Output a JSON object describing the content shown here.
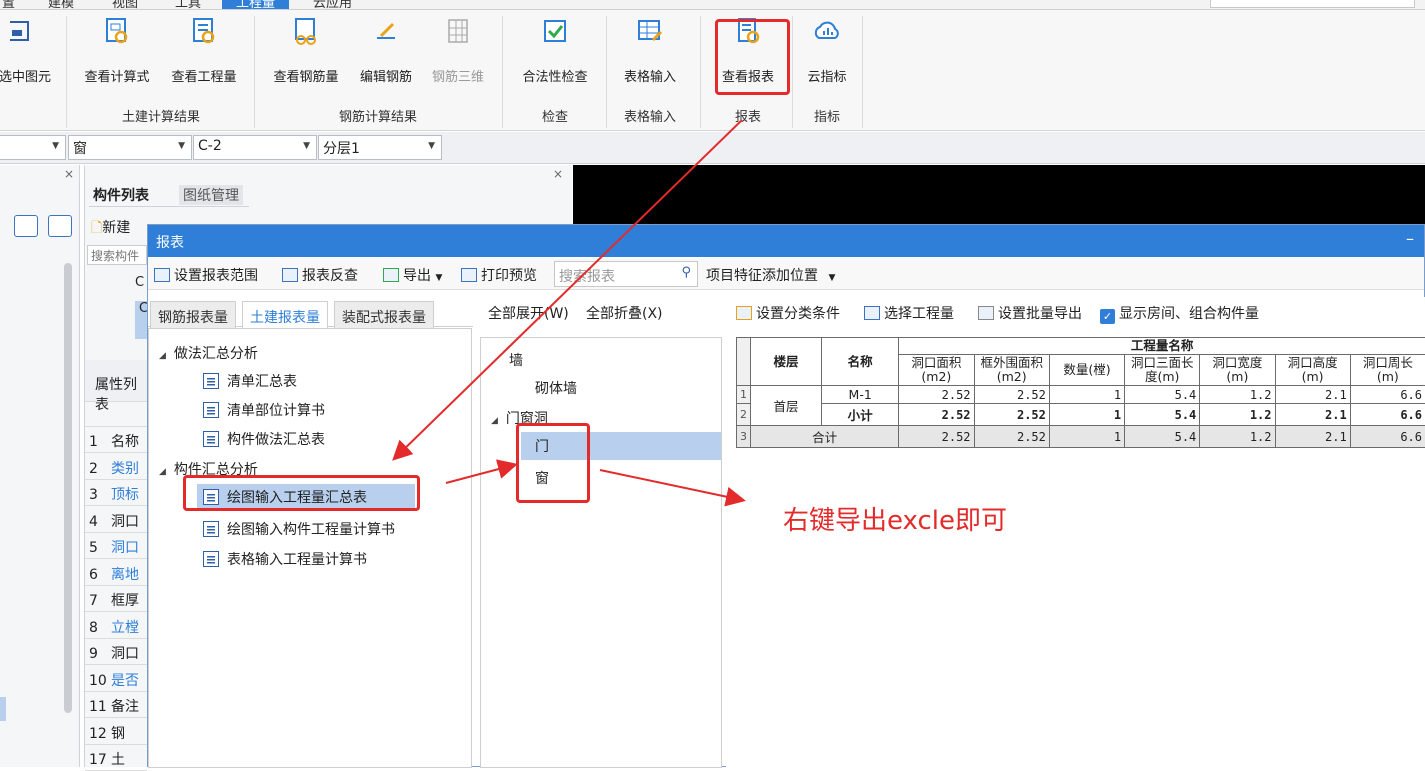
{
  "menubar": {
    "items": [
      "置",
      "建模",
      "视图",
      "工具",
      "工程量",
      "云应用"
    ],
    "active_index": 4
  },
  "ribbon": {
    "buttons": [
      {
        "label": "选中图元",
        "icon": "select-element-icon"
      },
      {
        "label": "查看计算式",
        "icon": "view-formula-icon"
      },
      {
        "label": "查看工程量",
        "icon": "view-quantity-icon"
      },
      {
        "label": "查看钢筋量",
        "icon": "view-rebar-icon"
      },
      {
        "label": "编辑钢筋",
        "icon": "edit-rebar-icon"
      },
      {
        "label": "钢筋三维",
        "icon": "rebar-3d-icon",
        "disabled": true
      },
      {
        "label": "合法性检查",
        "icon": "validity-check-icon"
      },
      {
        "label": "表格输入",
        "icon": "table-input-icon"
      },
      {
        "label": "查看报表",
        "icon": "view-report-icon"
      },
      {
        "label": "云指标",
        "icon": "cloud-index-icon"
      }
    ],
    "groups": [
      "土建计算结果",
      "钢筋计算结果",
      "检查",
      "表格输入",
      "报表",
      "指标"
    ]
  },
  "combobar": {
    "combo1": "",
    "combo2": "窗",
    "combo3": "C-2",
    "combo4": "分层1"
  },
  "mid_panel": {
    "tabs": [
      "构件列表",
      "图纸管理"
    ],
    "new_label": "新建",
    "search_placeholder": "搜索构件",
    "props_title": "属性列表",
    "rows": [
      {
        "n": "1",
        "t": "名称"
      },
      {
        "n": "2",
        "t": "类别"
      },
      {
        "n": "3",
        "t": "顶标"
      },
      {
        "n": "4",
        "t": "洞口"
      },
      {
        "n": "5",
        "t": "洞口"
      },
      {
        "n": "6",
        "t": "离地"
      },
      {
        "n": "7",
        "t": "框厚"
      },
      {
        "n": "8",
        "t": "立樘"
      },
      {
        "n": "9",
        "t": "洞口"
      },
      {
        "n": "10",
        "t": "是否"
      },
      {
        "n": "11",
        "t": "备注"
      },
      {
        "n": "12",
        "t": "钢"
      },
      {
        "n": "17",
        "t": "土"
      }
    ]
  },
  "dialog": {
    "title": "报表",
    "toolbar": {
      "set_range": "设置报表范围",
      "reverse": "报表反查",
      "export": "导出",
      "print_preview": "打印预览",
      "search_placeholder": "搜索报表",
      "add_position": "项目特征添加位置"
    },
    "tabs": [
      "钢筋报表量",
      "土建报表量",
      "装配式报表量"
    ],
    "active_tab": 1,
    "tree": {
      "group1": "做法汇总分析",
      "group1_items": [
        "清单汇总表",
        "清单部位计算书",
        "构件做法汇总表"
      ],
      "group2": "构件汇总分析",
      "group2_items": [
        "绘图输入工程量汇总表",
        "绘图输入构件工程量计算书",
        "表格输入工程量计算书"
      ]
    },
    "cat": {
      "expand_all": "全部展开(W)",
      "collapse_all": "全部折叠(X)",
      "items": [
        "墙",
        "砌体墙",
        "门窗洞",
        "门",
        "窗"
      ]
    },
    "grid_toolbar": {
      "set_category": "设置分类条件",
      "select_qty": "选择工程量",
      "batch_export": "设置批量导出",
      "show_room": "显示房间、组合构件量"
    },
    "grid": {
      "header_floor": "楼层",
      "header_name": "名称",
      "header_group": "工程量名称",
      "columns": [
        "洞口面积(m2)",
        "框外围面积(m2)",
        "数量(樘)",
        "洞口三面长度(m)",
        "洞口宽度(m)",
        "洞口高度(m)",
        "洞口周长(m)"
      ],
      "rows": [
        {
          "rownum": "1",
          "floor": "首层",
          "name": "M-1",
          "values": [
            "2.52",
            "2.52",
            "1",
            "5.4",
            "1.2",
            "2.1",
            "6.6"
          ]
        },
        {
          "rownum": "2",
          "floor": "",
          "name": "小计",
          "values": [
            "2.52",
            "2.52",
            "1",
            "5.4",
            "1.2",
            "2.1",
            "6.6"
          ]
        },
        {
          "rownum": "3",
          "floor": "合计",
          "name": "",
          "values": [
            "2.52",
            "2.52",
            "1",
            "5.4",
            "1.2",
            "2.1",
            "6.6"
          ]
        }
      ]
    }
  },
  "annotation": "右键导出excle即可",
  "colors": {
    "accent": "#2f7fd8",
    "annotation_red": "#e32b2b",
    "selected_row": "#b8d0ee"
  }
}
